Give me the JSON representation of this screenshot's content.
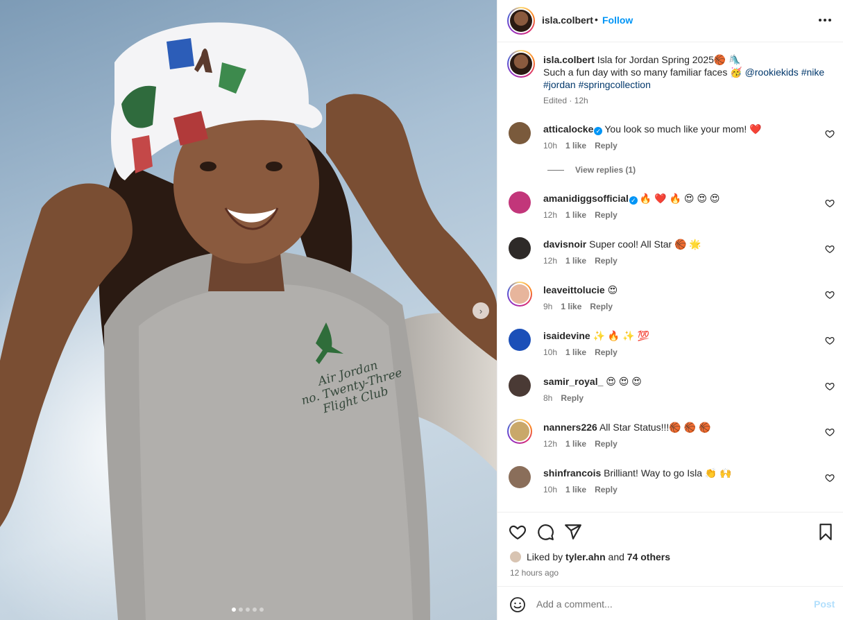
{
  "post": {
    "image": {
      "carousel_count": 5,
      "active_index": 0,
      "shirt_text": [
        "Air Jordan",
        "no. Twenty-Three",
        "Flight Club"
      ]
    },
    "header": {
      "username": "isla.colbert",
      "separator": "•",
      "follow_label": "Follow"
    },
    "caption": {
      "username": "isla.colbert",
      "text_1": " Isla for Jordan Spring 2025🏀 🛝",
      "text_2": "Such a fun day with so many familiar faces 🥳 ",
      "mention": "@rookiekids",
      "tags": [
        "#nike",
        "#jordan",
        "#springcollection"
      ],
      "meta": "Edited · 12h"
    },
    "comments": [
      {
        "username": "atticalocke",
        "verified": true,
        "text": "You look so much like your mom! ❤️",
        "time": "10h",
        "likes": "1 like",
        "reply": "Reply",
        "avatar_color": "#7a5a3c"
      },
      {
        "username": "amanidiggsofficial",
        "verified": true,
        "text": "🔥 ❤️ 🔥 😍 😍 😍",
        "time": "12h",
        "likes": "1 like",
        "reply": "Reply",
        "avatar_color": "#c2367a"
      },
      {
        "username": "davisnoir",
        "verified": false,
        "text": "Super cool! All Star 🏀 🌟",
        "time": "12h",
        "likes": "1 like",
        "reply": "Reply",
        "avatar_color": "#2e2a28"
      },
      {
        "username": "leaveittolucie",
        "verified": false,
        "text": "😍",
        "time": "9h",
        "likes": "1 like",
        "reply": "Reply",
        "avatar_color": "#e7b59c"
      },
      {
        "username": "isaidevine",
        "verified": false,
        "text": "✨ 🔥 ✨ 💯",
        "time": "10h",
        "likes": "1 like",
        "reply": "Reply",
        "avatar_color": "#1b4fb8"
      },
      {
        "username": "samir_royal_",
        "verified": false,
        "text": "😍 😍 😍",
        "time": "8h",
        "likes": "",
        "reply": "Reply",
        "avatar_color": "#4a3a35"
      },
      {
        "username": "nanners226",
        "verified": false,
        "text": "All Star Status!!!🏀 🏀 🏀",
        "time": "12h",
        "likes": "1 like",
        "reply": "Reply",
        "avatar_color": "#c9a86a"
      },
      {
        "username": "shinfrancois",
        "verified": false,
        "text": "Brilliant! Way to go Isla 👏 🙌",
        "time": "10h",
        "likes": "1 like",
        "reply": "Reply",
        "avatar_color": "#8a6e5a"
      }
    ],
    "view_replies": "View replies (1)",
    "likes": {
      "prefix": "Liked by ",
      "user": "tyler.ahn",
      "middle": " and ",
      "others": "74 others"
    },
    "time_ago": "12 hours ago",
    "add_comment": {
      "placeholder": "Add a comment...",
      "post_label": "Post"
    },
    "colors": {
      "accent": "#0095f6",
      "hashtag": "#00376b",
      "muted": "#737373"
    }
  }
}
